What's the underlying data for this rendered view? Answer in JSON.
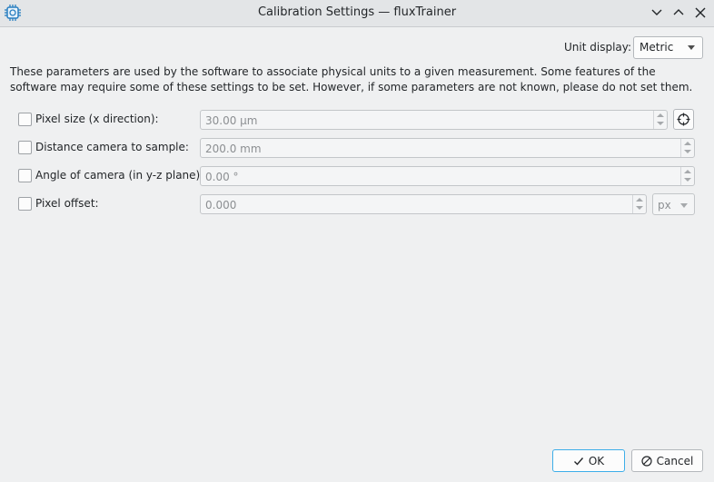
{
  "window": {
    "title": "Calibration Settings — fluxTrainer",
    "icon": "chip-icon",
    "controls": [
      "chevron-down-icon",
      "chevron-up-icon",
      "close-icon"
    ]
  },
  "unit_display": {
    "label": "Unit display:",
    "value": "Metric"
  },
  "description": "These parameters are used by the software to associate physical units to a given measurement. Some features of the software may require some of these settings to be set. However, if some parameters are not known, please do not set them.",
  "params": [
    {
      "label": "Pixel size (x direction):",
      "value": "30.00 µm",
      "checked": false
    },
    {
      "label": "Distance camera to sample:",
      "value": "200.0 mm",
      "checked": false
    },
    {
      "label": "Angle of camera (in y-z plane):",
      "value": "0.00 °",
      "checked": false
    },
    {
      "label": "Pixel offset:",
      "value": "0.000",
      "checked": false,
      "unit": "px"
    }
  ],
  "buttons": {
    "ok": "OK",
    "cancel": "Cancel"
  },
  "colors": {
    "accent": "#3daee9",
    "background": "#eff0f1"
  }
}
